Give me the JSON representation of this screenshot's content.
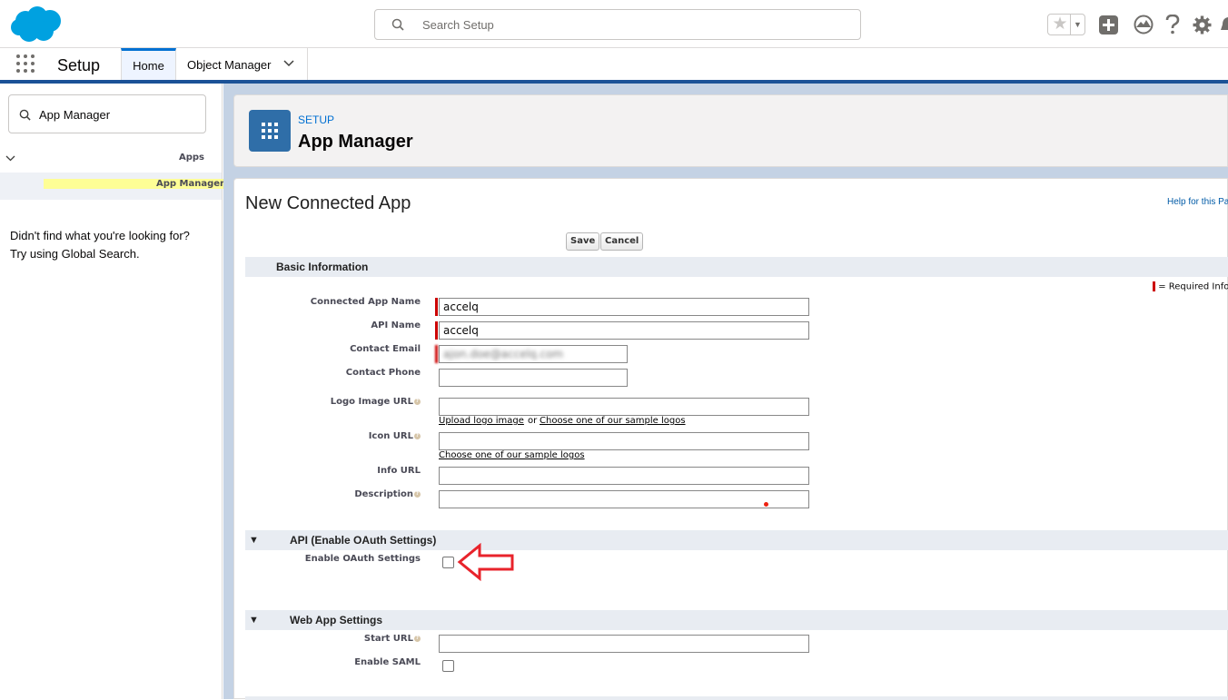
{
  "header": {
    "search_placeholder": "Search Setup",
    "icons": [
      "salesforce-logo",
      "search-icon",
      "favorites-star-icon",
      "chevron-down-icon",
      "add-icon",
      "trailhead-icon",
      "help-icon",
      "gear-icon"
    ]
  },
  "nav": {
    "app_name": "Setup",
    "tabs": [
      {
        "label": "Home"
      },
      {
        "label": "Object Manager"
      }
    ]
  },
  "sidebar": {
    "quick_find_value": "App Manager",
    "tree_parent": "Apps",
    "tree_child": "App Manager",
    "not_found_line1": "Didn't find what you're looking for?",
    "not_found_line2": "Try using Global Search."
  },
  "page_header": {
    "breadcrumb": "SETUP",
    "title": "App Manager"
  },
  "form": {
    "title": "New Connected App",
    "help_link": "Help for this Pa",
    "save_label": "Save",
    "cancel_label": "Cancel",
    "required_legend": "= Required Infor",
    "sections": {
      "basic": "Basic Information",
      "api": "API (Enable OAuth Settings)",
      "web": "Web App Settings"
    },
    "fields": {
      "connected_app_name": {
        "label": "Connected App Name",
        "value": "accelq"
      },
      "api_name": {
        "label": "API Name",
        "value": "accelq"
      },
      "contact_email": {
        "label": "Contact Email",
        "value": "ajon.doe@accelq.com"
      },
      "contact_phone": {
        "label": "Contact Phone",
        "value": ""
      },
      "logo_image_url": {
        "label": "Logo Image URL",
        "value": ""
      },
      "icon_url": {
        "label": "Icon URL",
        "value": ""
      },
      "info_url": {
        "label": "Info URL",
        "value": ""
      },
      "description": {
        "label": "Description",
        "value": ""
      },
      "enable_oauth": {
        "label": "Enable OAuth Settings",
        "checked": false
      },
      "start_url": {
        "label": "Start URL",
        "value": ""
      },
      "enable_saml": {
        "label": "Enable SAML",
        "checked": false
      }
    },
    "links": {
      "upload_logo": "Upload logo image",
      "or_text": "or",
      "sample_logos": "Choose one of our sample logos",
      "sample_logos_icon": "Choose one of our sample logos"
    }
  },
  "colors": {
    "brand_blue": "#1b5297",
    "link_blue": "#0070d2",
    "required_red": "#c00000",
    "annotation_red": "#e8232b",
    "section_bg": "#e8ecf2"
  }
}
